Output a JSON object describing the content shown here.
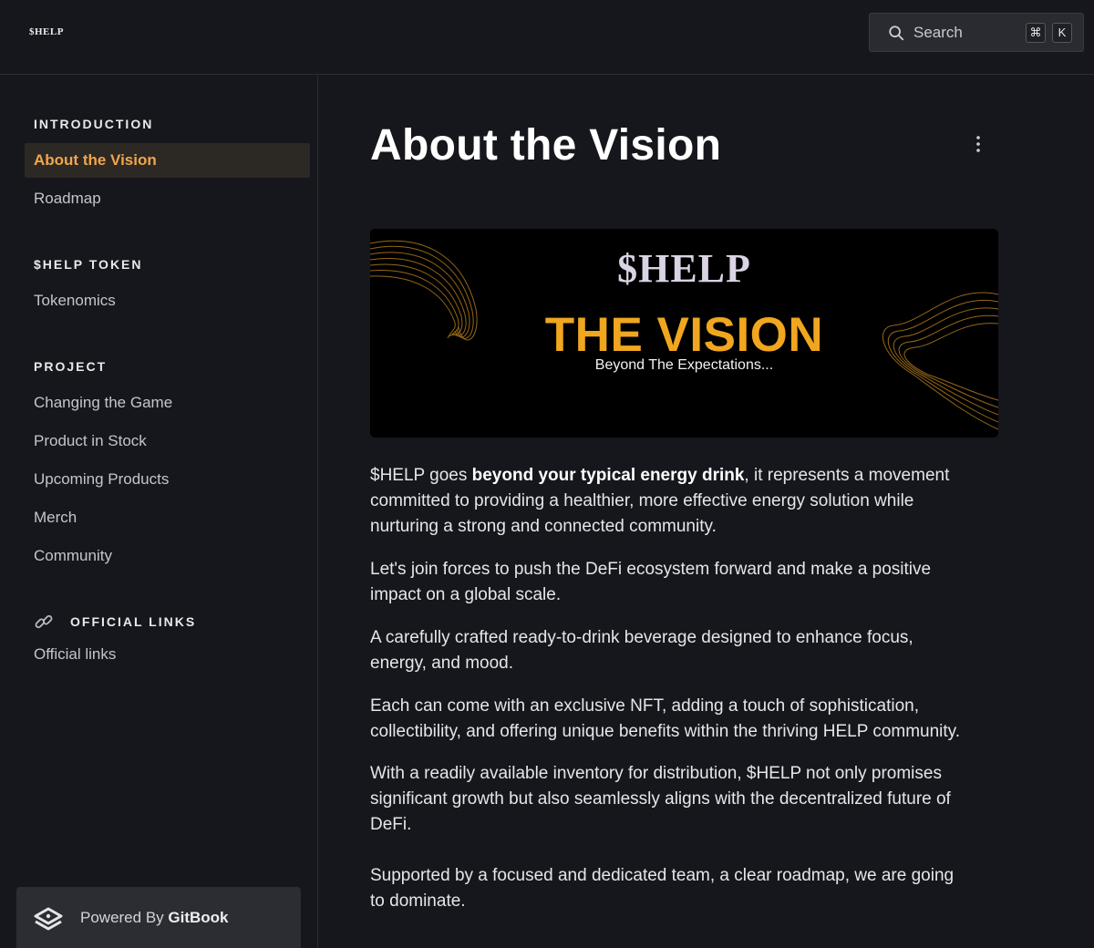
{
  "header": {
    "logo": "$HELP",
    "search": {
      "label": "Search",
      "shortcut_mod": "⌘",
      "shortcut_key": "K"
    }
  },
  "sidebar": {
    "sections": [
      {
        "title": "INTRODUCTION",
        "items": [
          "About the Vision",
          "Roadmap"
        ]
      },
      {
        "title": "$HELP TOKEN",
        "items": [
          "Tokenomics"
        ]
      },
      {
        "title": "PROJECT",
        "items": [
          "Changing the Game",
          "Product in Stock",
          "Upcoming Products",
          "Merch",
          "Community"
        ]
      },
      {
        "title": "OFFICIAL LINKS",
        "items": [
          "Official links"
        ]
      }
    ],
    "active_item": "About the Vision",
    "footer": {
      "prefix": "Powered By ",
      "brand": "GitBook"
    }
  },
  "main": {
    "title": "About the Vision",
    "banner": {
      "brand": "$HELP",
      "title": "THE VISION",
      "subtitle": "Beyond The Expectations..."
    },
    "paragraphs": [
      {
        "pre": "$HELP goes ",
        "bold": "beyond your typical energy drink",
        "line1_rest": ", it represents a movement",
        "line2": "committed to providing a healthier, more effective energy solution while",
        "line3": "nurturing a strong and connected community."
      },
      {
        "line1": "Let's join forces to push the DeFi ecosystem forward and make a positive",
        "line2": "impact on a global scale."
      },
      {
        "line1": "A carefully crafted ready-to-drink beverage designed to enhance focus,",
        "line2": "energy, and mood."
      },
      {
        "line1": "Each can come with an exclusive NFT, adding a touch of sophistication,",
        "line2": "collectibility, and offering unique benefits within the thriving HELP community."
      },
      {
        "line1": "With a readily available inventory for distribution, $HELP not only promises",
        "line2": "significant growth but also seamlessly aligns with the decentralized future of",
        "line3": "DeFi."
      },
      {
        "line1": "Supported by a focused and dedicated team, a clear roadmap,  we are going",
        "line2": "to dominate."
      }
    ]
  },
  "colors": {
    "accent": "#f0a64b",
    "background": "#16171c",
    "banner_title": "#f0a61e"
  }
}
